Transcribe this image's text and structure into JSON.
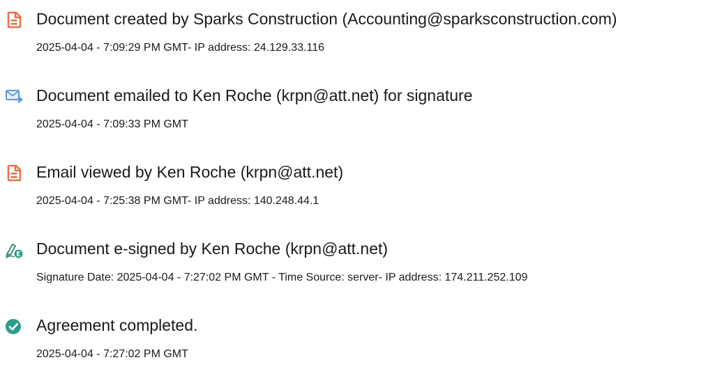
{
  "events": [
    {
      "icon": "document-created-icon",
      "title": "Document created by Sparks Construction (Accounting@sparksconstruction.com)",
      "detail": "2025-04-04 - 7:09:29 PM GMT- IP address: 24.129.33.116"
    },
    {
      "icon": "email-sent-icon",
      "title": "Document emailed to Ken Roche (krpn@att.net) for signature",
      "detail": "2025-04-04 - 7:09:33 PM GMT"
    },
    {
      "icon": "document-viewed-icon",
      "title": "Email viewed by Ken Roche (krpn@att.net)",
      "detail": "2025-04-04 - 7:25:38 PM GMT- IP address: 140.248.44.1"
    },
    {
      "icon": "e-signature-icon",
      "title": "Document e-signed by Ken Roche (krpn@att.net)",
      "detail": "Signature Date: 2025-04-04 - 7:27:02 PM GMT - Time Source: server- IP address: 174.211.252.109"
    },
    {
      "icon": "checkmark-circle-icon",
      "title": "Agreement completed.",
      "detail": "2025-04-04 - 7:27:02 PM GMT"
    }
  ],
  "colors": {
    "text": "#1a1a1a",
    "document_icon": "#e8734a",
    "email_icon": "#5b9bd5",
    "sign_icon_pen": "#3f8a7a",
    "sign_icon_badge": "#2f9c8c",
    "complete_icon": "#2e9c8c"
  }
}
